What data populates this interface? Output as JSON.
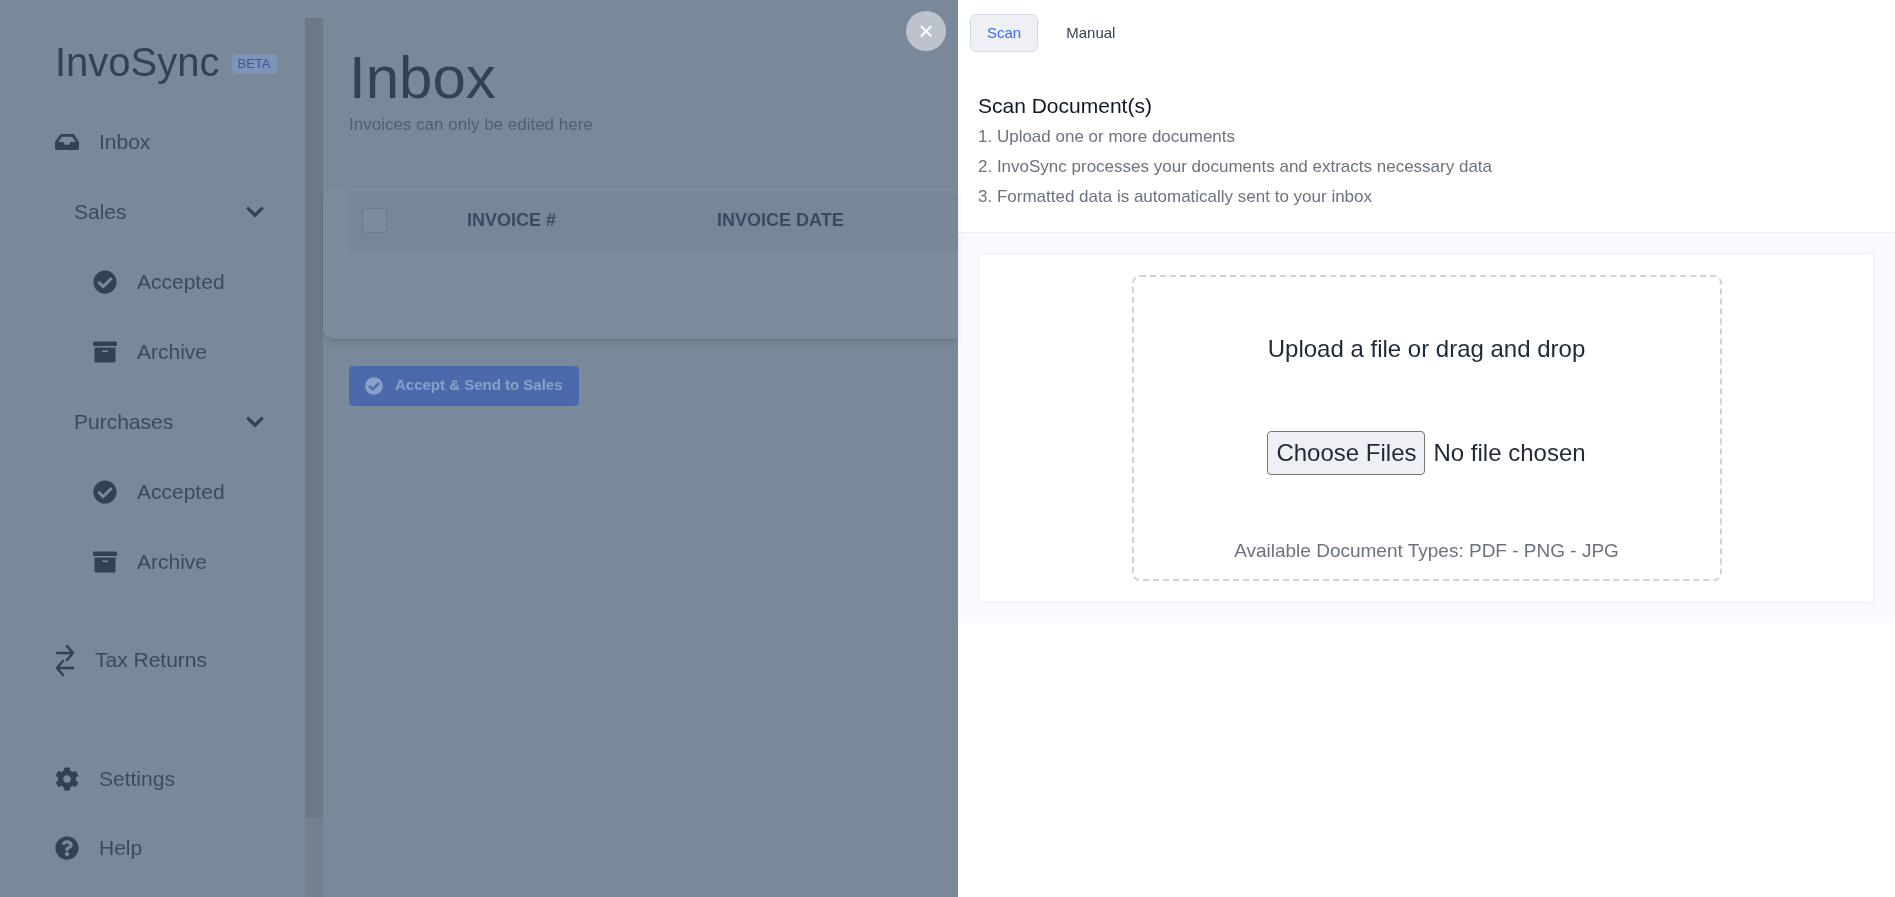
{
  "sidebar": {
    "logo": "InvoSync",
    "badge": "BETA",
    "items": [
      {
        "kind": "link",
        "label": "Inbox"
      },
      {
        "kind": "group",
        "label": "Sales",
        "expanded": true,
        "children": [
          {
            "label": "Accepted"
          },
          {
            "label": "Archive"
          }
        ]
      },
      {
        "kind": "group",
        "label": "Purchases",
        "expanded": true,
        "children": [
          {
            "label": "Accepted"
          },
          {
            "label": "Archive"
          }
        ]
      },
      {
        "kind": "link",
        "label": "Tax Returns"
      }
    ],
    "footer": [
      {
        "label": "Settings"
      },
      {
        "label": "Help"
      }
    ]
  },
  "main": {
    "title": "Inbox",
    "subtitle": "Invoices can only be edited here",
    "table": {
      "select_all": {
        "checked": false
      },
      "columns": [
        "INVOICE #",
        "INVOICE DATE"
      ]
    },
    "action_button": "Accept & Send to Sales"
  },
  "panel": {
    "close": "×",
    "tabs": [
      {
        "label": "Scan",
        "selected": true
      },
      {
        "label": "Manual",
        "selected": false
      }
    ],
    "heading": "Scan Document(s)",
    "steps": [
      "1. Upload one or more documents",
      "2. InvoSync processes your documents and extracts necessary data",
      "3. Formatted data is automatically sent to your inbox"
    ],
    "upload": {
      "prompt": "Upload a file or drag and drop",
      "button": "Choose Files",
      "status": "No file chosen",
      "types": "Available Document Types: PDF - PNG - JPG"
    }
  }
}
